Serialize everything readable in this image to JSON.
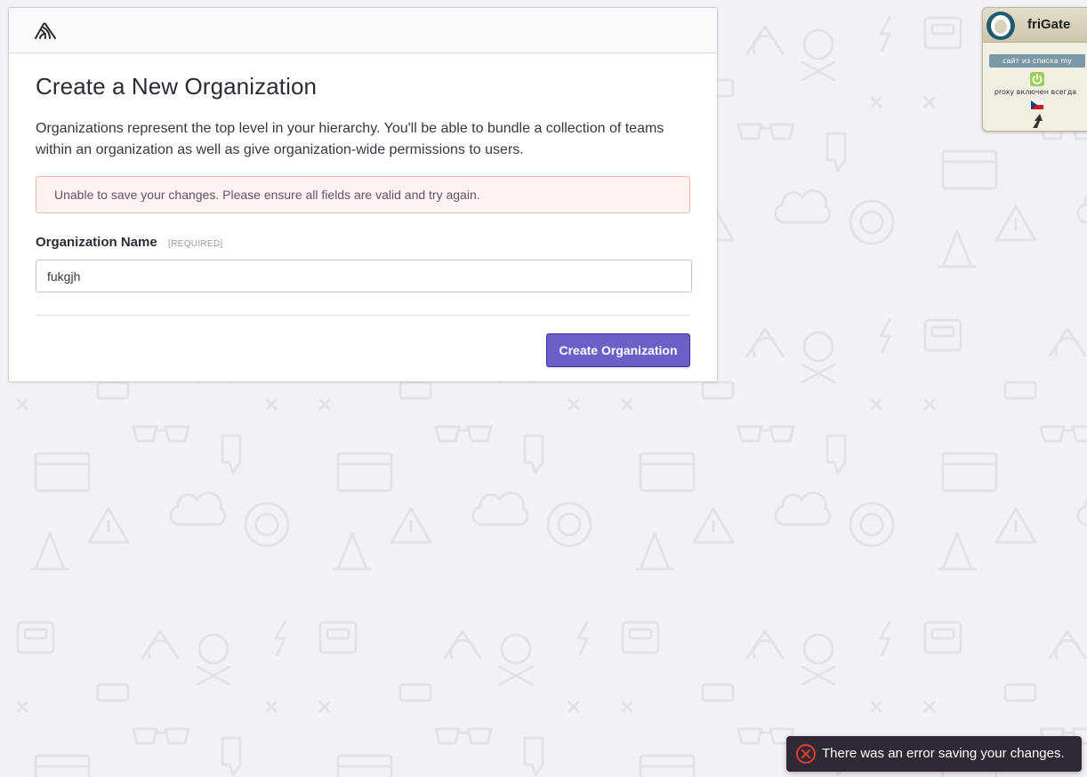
{
  "page": {
    "title": "Create a New Organization",
    "intro": "Organizations represent the top level in your hierarchy. You'll be able to bundle a collection of teams within an organization as well as give organization-wide permissions to users.",
    "logo_icon": "sentry-logo-icon"
  },
  "alert": {
    "message": "Unable to save your changes. Please ensure all fields are valid and try again."
  },
  "form": {
    "org_name_label": "Organization Name",
    "required_badge": "[REQUIRED]",
    "org_name_value": "fukgjh"
  },
  "actions": {
    "create_label": "Create Organization"
  },
  "extension": {
    "name": "friGate",
    "site_button": "сайт из списка my",
    "status": "proxy включен всегда",
    "power_icon": "power-icon",
    "flag_icon": "czech-flag-icon",
    "arrow_icon": "arrow-up-icon"
  },
  "toast": {
    "message": "There was an error saving your changes.",
    "icon": "error-circle-icon"
  },
  "colors": {
    "accent": "#6c5fc7",
    "background": "#f2f1f3",
    "alert_border": "#f3b6ad",
    "alert_bg": "#fdf3f2",
    "toast_bg": "#2f2936",
    "error": "#e03e2f"
  }
}
